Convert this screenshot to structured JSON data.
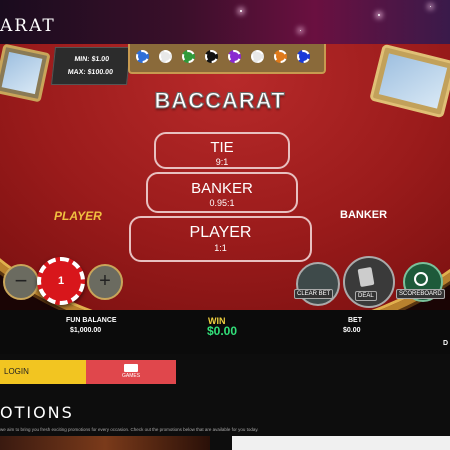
{
  "header": {
    "logo_text": "ARAT"
  },
  "table": {
    "limits": {
      "min": "MIN: $1.00",
      "max": "MAX: $100.00"
    },
    "title": "BACCARAT",
    "tie": {
      "label": "TIE",
      "odds": "9:1"
    },
    "banker": {
      "label": "BANKER",
      "odds": "0.95:1"
    },
    "player": {
      "label": "PLAYER",
      "odds": "1:1"
    },
    "player_side_label": "PLAYER",
    "banker_side_label": "BANKER",
    "chip_tray_colors": [
      "#2f6fd8",
      "#e8e8e8",
      "#2f9a3a",
      "#111111",
      "#8a2ad0",
      "#e8e8e8",
      "#e07a1a",
      "#1a3ad8"
    ]
  },
  "controls": {
    "minus": "−",
    "plus": "+",
    "chip_value": "1",
    "clear_bet": "CLEAR BET",
    "deal": "DEAL",
    "scoreboard": "SCOREBOARD"
  },
  "info": {
    "fun_balance_label": "FUN BALANCE",
    "fun_balance_value": "$1,000.00",
    "win_label": "WIN",
    "win_value": "$0.00",
    "bet_label": "BET",
    "bet_value": "$0.00",
    "edge_text": "D"
  },
  "nav": {
    "login": "LOGIN",
    "games": "GAMES"
  },
  "promotions": {
    "title": "OTIONS",
    "text": "we aim to bring you fresh exciting promotions for every occasion. Check out the promotions below that are available for you today."
  },
  "colors": {
    "felt": "#9a1b1b",
    "gold": "#c9a55a",
    "login": "#f2c521",
    "games": "#e0474c",
    "win_value": "#32e07a"
  }
}
